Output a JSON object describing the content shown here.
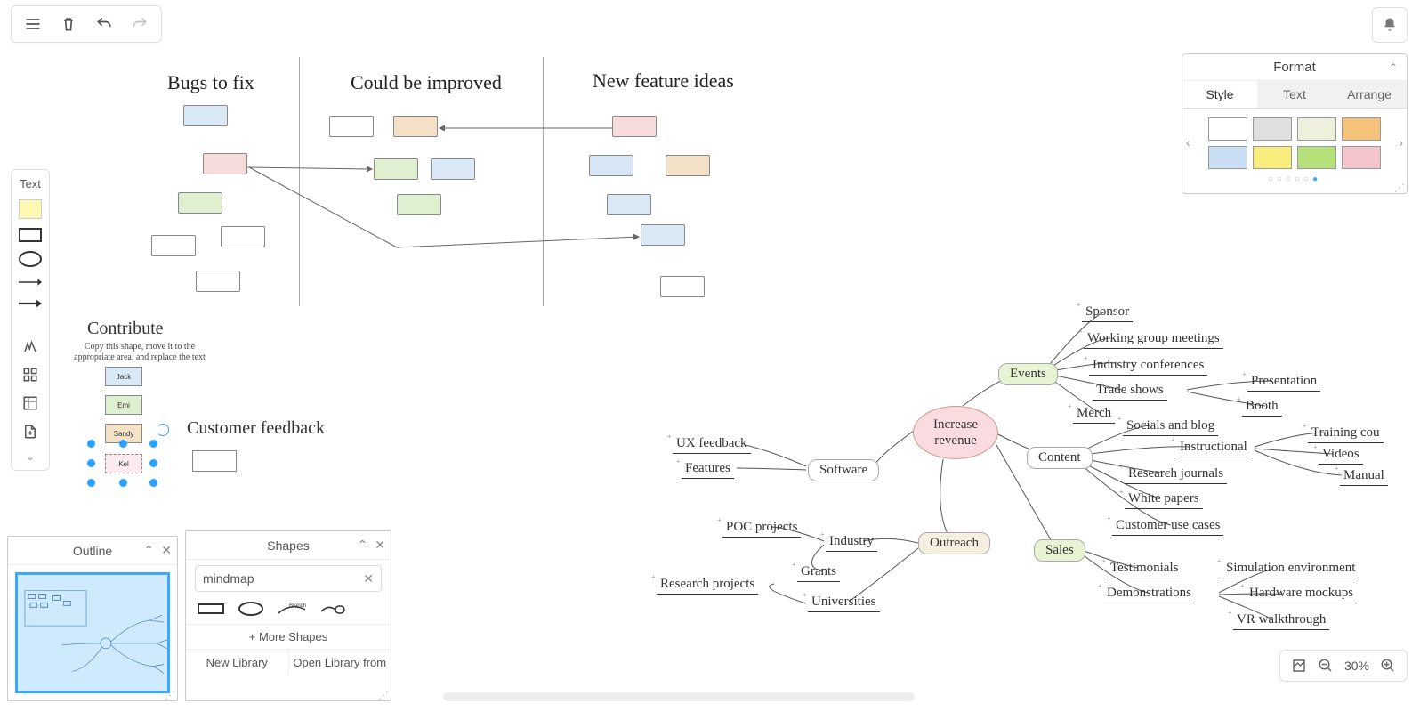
{
  "toolbar": {
    "text_label": "Text"
  },
  "columns": {
    "c1": "Bugs to fix",
    "c2": "Could be improved",
    "c3": "New feature ideas"
  },
  "contribute": {
    "title": "Contribute",
    "hint": "Copy this shape, move it to the appropriate area, and replace the text",
    "names": [
      "Jack",
      "Emi",
      "Sandy",
      "Kel"
    ]
  },
  "customer": {
    "title": "Customer feedback"
  },
  "mindmap": {
    "center": "Increase revenue",
    "software": {
      "label": "Software",
      "leaves": [
        "UX feedback",
        "Features"
      ]
    },
    "outreach": {
      "label": "Outreach",
      "industry": "Industry",
      "universities": "Universities",
      "poc": "POC projects",
      "grants": "Grants",
      "research": "Research projects"
    },
    "events": {
      "label": "Events",
      "leaves": [
        "Sponsor",
        "Working group meetings",
        "Industry conferences",
        "Trade shows",
        "Merch"
      ],
      "trade": [
        "Presentation",
        "Booth"
      ]
    },
    "content": {
      "label": "Content",
      "leaves": [
        "Socials and blog",
        "Instructional",
        "Research journals",
        "White papers",
        "Customer use cases"
      ],
      "instructional": [
        "Training cou",
        "Videos",
        "Manual"
      ]
    },
    "sales": {
      "label": "Sales",
      "leaves": [
        "Testimonials",
        "Demonstrations"
      ],
      "demo": [
        "Simulation environment",
        "Hardware mockups",
        "VR walkthrough"
      ]
    }
  },
  "outline": {
    "title": "Outline"
  },
  "shapes": {
    "title": "Shapes",
    "search": "mindmap",
    "more": "More Shapes",
    "new_lib": "New Library",
    "open_lib": "Open Library from"
  },
  "format": {
    "title": "Format",
    "tabs": {
      "style": "Style",
      "text": "Text",
      "arrange": "Arrange"
    }
  },
  "zoom": {
    "level": "30%"
  }
}
